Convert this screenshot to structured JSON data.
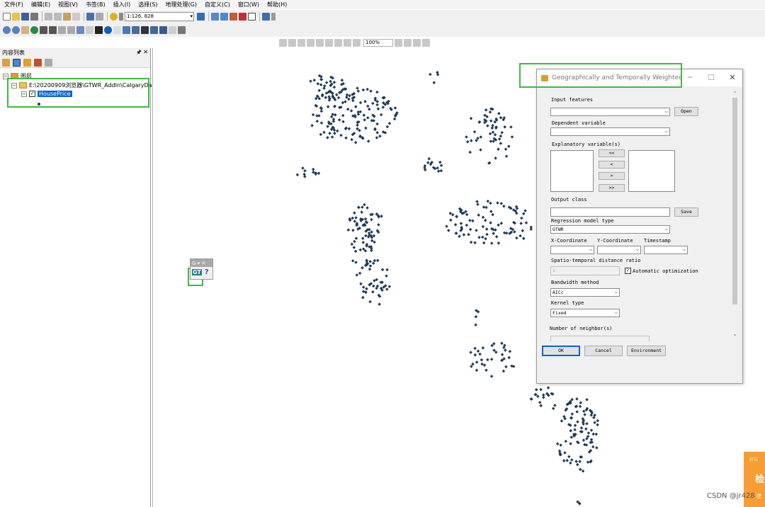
{
  "menu": [
    "文件(F)",
    "编辑(E)",
    "视图(V)",
    "书签(B)",
    "插入(I)",
    "选择(S)",
    "地理处理(G)",
    "自定义(C)",
    "窗口(W)",
    "帮助(H)"
  ],
  "toolbar": {
    "scale": "1:126, 828",
    "zoom": "100%"
  },
  "toc": {
    "title": "内容列表",
    "pin": "🖈 ✕",
    "layers_root": "图层",
    "data_path": "E:\\20200909浏览器\\GTWR_AddIn\\CalgaryDa",
    "layer_name": "HousePrice"
  },
  "gt_toolbar": {
    "title": "G ▾ ✕",
    "button": "GT",
    "help": "?"
  },
  "dialog": {
    "title": "Geographically and Temporally Weighted R...",
    "minimize": "─",
    "maximize": "☐",
    "close": "✕",
    "input_features_label": "Input features",
    "input_features_value": "",
    "open_button": "Open",
    "dependent_variable_label": "Dependent variable",
    "explanatory_variables_label": "Explanatory variable(s)",
    "move_all_left": "<<",
    "move_left": "<",
    "move_right": ">",
    "move_all_right": ">>",
    "output_class_label": "Output class",
    "save_button": "Save",
    "regression_model_type_label": "Regression model type",
    "regression_model_type_value": "GTWR",
    "x_coordinate_label": "X-Coordinate",
    "y_coordinate_label": "Y-Coordinate",
    "timestamp_label": "Timestamp",
    "ratio_label": "Spatio-temporal distance ratio",
    "ratio_value": "1",
    "auto_optimization_label": "Automatic optimization",
    "auto_optimization_checked": true,
    "bandwidth_method_label": "Bandwidth method",
    "bandwidth_method_value": "AICc",
    "kernel_type_label": "Kernel type",
    "kernel_type_value": "Fixed",
    "neighbors_label": "Number of neighbor(s)",
    "ok_button": "OK",
    "cancel_button": "Cancel",
    "environment_button": "Environment"
  },
  "csdn_widget": {
    "top": "好玩",
    "mid": "检",
    "bottom": "建"
  },
  "watermark": "CSDN @jr428",
  "colors": {
    "point": "#1f3a56",
    "highlight": "#3dbb3d",
    "selection": "#0a64d0",
    "widget": "#f79d34"
  }
}
